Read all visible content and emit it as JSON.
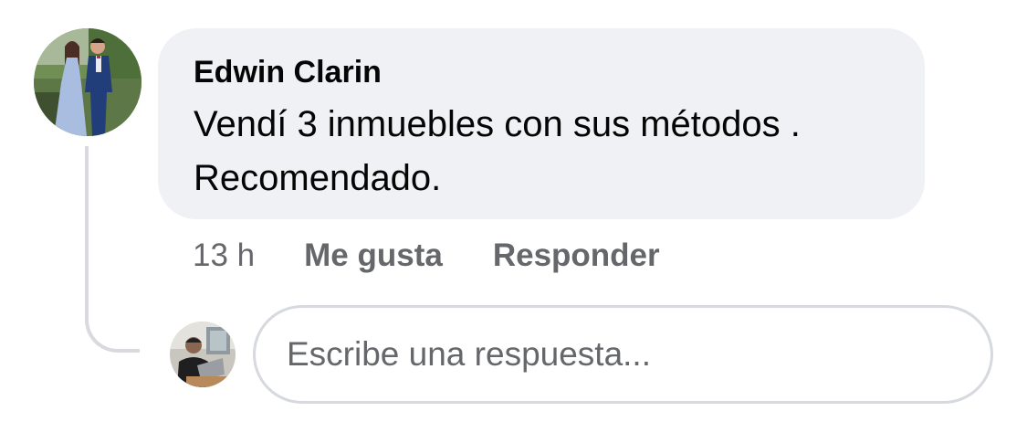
{
  "comment": {
    "author": "Edwin Clarin",
    "text_lines": [
      "Vendí 3 inmuebles con sus métodos .",
      "Recomendado."
    ],
    "timestamp": "13 h"
  },
  "actions": {
    "like_label": "Me gusta",
    "reply_label": "Responder"
  },
  "reply": {
    "placeholder": "Escribe una respuesta..."
  },
  "colors": {
    "bubble_bg": "#f0f1f4",
    "primary_text": "#050505",
    "secondary_text": "#65676b",
    "border": "#d6d9de"
  }
}
